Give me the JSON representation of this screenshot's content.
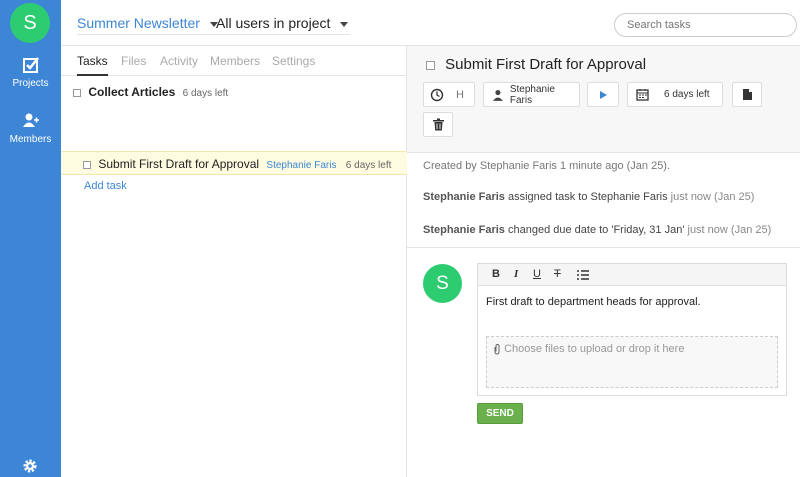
{
  "sidebar": {
    "logo_letter": "S",
    "projects_label": "Projects",
    "members_label": "Members"
  },
  "header": {
    "project": "Summer Newsletter",
    "users_filter": "All users in project",
    "search_placeholder": "Search tasks"
  },
  "left": {
    "tabs": [
      "Tasks",
      "Files",
      "Activity",
      "Members",
      "Settings"
    ],
    "group_title": "Collect Articles",
    "group_due": "6 days left",
    "task_title": "Submit First Draft for Approval",
    "task_assignee": "Stephanie Faris",
    "task_due": "6 days left",
    "add_task": "Add task"
  },
  "right": {
    "title": "Submit First Draft for Approval",
    "hours_placeholder": "H",
    "assignee": "Stephanie Faris",
    "due": "6 days left",
    "created": "Created by Stephanie Faris 1 minute ago (Jan 25).",
    "activity1_who": "Stephanie Faris",
    "activity1_text": "assigned task to Stephanie Faris",
    "activity1_when": "just now (Jan 25)",
    "activity2_who": "Stephanie Faris",
    "activity2_text": "changed due date to 'Friday, 31 Jan'",
    "activity2_when": "just now (Jan 25)",
    "avatar_letter": "S",
    "editor_text": "First draft to department heads for approval.",
    "dropzone": "Choose files to upload or drop it here",
    "send_label": "SEND",
    "format_buttons": [
      "B",
      "I",
      "U",
      "T"
    ]
  },
  "colors": {
    "sidebar": "#3d86d6",
    "avatar": "#2ecc71",
    "send": "#6ab04c",
    "highlight_row": "#fdfbe0"
  },
  "icons": [
    "projects-icon",
    "members-icon",
    "settings-icon",
    "clock-icon",
    "user-icon",
    "play-icon",
    "calendar-icon",
    "document-icon",
    "trash-icon",
    "list-icon",
    "paperclip-icon"
  ]
}
